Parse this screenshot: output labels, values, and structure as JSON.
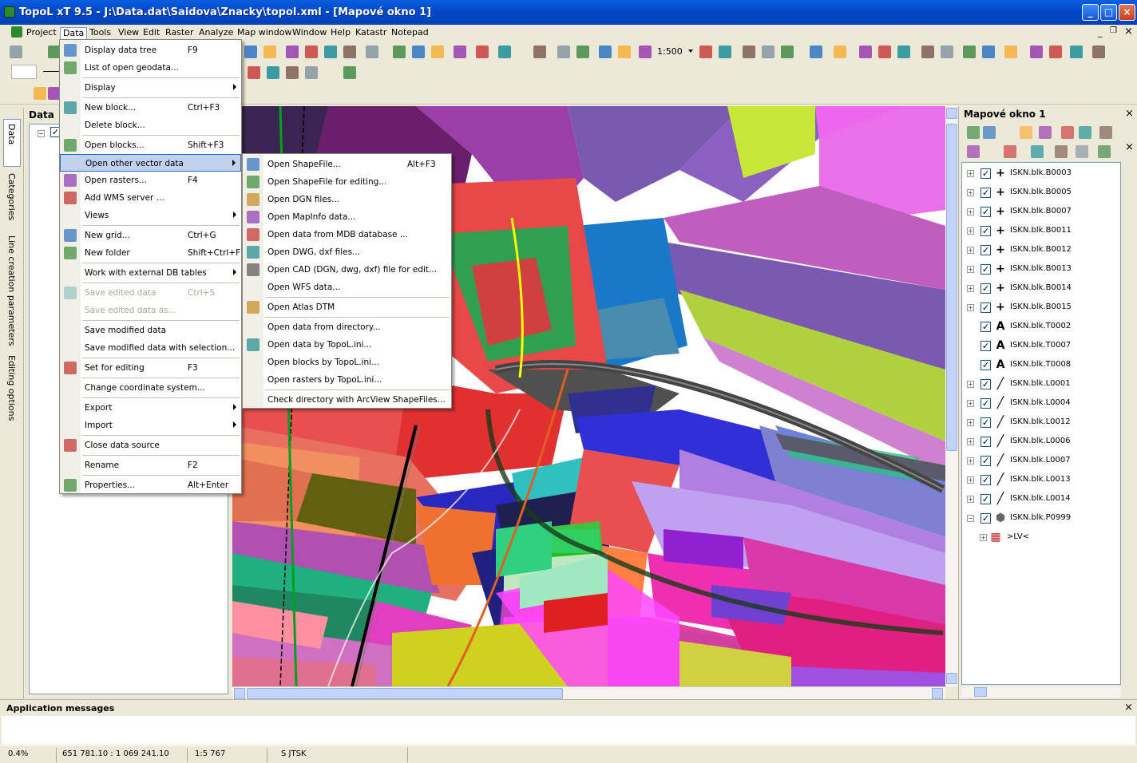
{
  "window": {
    "title": "TopoL xT 9.5 - J:\\Data.dat\\Saidova\\Znacky\\topol.xml - [Mapové okno 1]"
  },
  "menubar": [
    "Project",
    "Data",
    "Tools",
    "View",
    "Edit",
    "Raster",
    "Analyze",
    "Map window",
    "Window",
    "Help",
    "Katastr",
    "Notepad"
  ],
  "toolbar": {
    "scale": "1:500"
  },
  "left_tabs": [
    "Data",
    "Categories",
    "Line creation parameters",
    "Editing options"
  ],
  "data_panel": {
    "title": "Data"
  },
  "data_menu": [
    {
      "label": "Display data tree",
      "shortcut": "F9",
      "icon": "tree-icon"
    },
    {
      "label": "List of open geodata...",
      "shortcut": "",
      "icon": "list-icon"
    },
    {
      "sep": true
    },
    {
      "label": "Display",
      "shortcut": "",
      "submenu": true
    },
    {
      "sep": true
    },
    {
      "label": "New block...",
      "shortcut": "Ctrl+F3",
      "icon": "new-block-icon"
    },
    {
      "label": "Delete block...",
      "shortcut": ""
    },
    {
      "sep": true
    },
    {
      "label": "Open blocks...",
      "shortcut": "Shift+F3",
      "icon": "open-blocks-icon"
    },
    {
      "label": "Open other vector data",
      "shortcut": "",
      "submenu": true,
      "highlight": true
    },
    {
      "label": "Open rasters...",
      "shortcut": "F4",
      "icon": "raster-icon"
    },
    {
      "label": "Add WMS server ...",
      "shortcut": "",
      "icon": "globe-icon"
    },
    {
      "label": "Views",
      "shortcut": "",
      "submenu": true
    },
    {
      "sep": true
    },
    {
      "label": "New grid...",
      "shortcut": "Ctrl+G",
      "icon": "grid-icon"
    },
    {
      "label": "New folder",
      "shortcut": "Shift+Ctrl+F",
      "icon": "folder-icon"
    },
    {
      "sep": true
    },
    {
      "label": "Work with external DB tables",
      "shortcut": "",
      "submenu": true
    },
    {
      "sep": true
    },
    {
      "label": "Save edited data",
      "shortcut": "Ctrl+S",
      "disabled": true,
      "icon": "save-icon"
    },
    {
      "label": "Save edited data as...",
      "shortcut": "",
      "disabled": true
    },
    {
      "sep": true
    },
    {
      "label": "Save modified data",
      "shortcut": ""
    },
    {
      "label": "Save modified data with selection...",
      "shortcut": ""
    },
    {
      "sep": true
    },
    {
      "label": "Set for editing",
      "shortcut": "F3",
      "icon": "edit-icon"
    },
    {
      "sep": true
    },
    {
      "label": "Change coordinate system...",
      "shortcut": ""
    },
    {
      "sep": true
    },
    {
      "label": "Export",
      "shortcut": "",
      "submenu": true
    },
    {
      "label": "Import",
      "shortcut": "",
      "submenu": true
    },
    {
      "sep": true
    },
    {
      "label": "Close data source",
      "shortcut": "",
      "icon": "close-folder-icon"
    },
    {
      "sep": true
    },
    {
      "label": "Rename",
      "shortcut": "F2"
    },
    {
      "sep": true
    },
    {
      "label": "Properties...",
      "shortcut": "Alt+Enter",
      "icon": "properties-icon"
    }
  ],
  "vector_submenu": [
    {
      "label": "Open ShapeFile...",
      "shortcut": "Alt+F3",
      "icon": "shapefile-icon"
    },
    {
      "label": "Open ShapeFile for editing...",
      "shortcut": "",
      "icon": "shapefile-edit-icon"
    },
    {
      "label": "Open DGN files...",
      "shortcut": "",
      "icon": "dgn-icon"
    },
    {
      "label": "Open MapInfo data...",
      "shortcut": "",
      "icon": "mapinfo-icon"
    },
    {
      "label": "Open data from MDB database ...",
      "shortcut": "",
      "icon": "database-icon"
    },
    {
      "label": "Open DWG, dxf files...",
      "shortcut": "",
      "icon": "dwg-icon"
    },
    {
      "label": "Open CAD (DGN, dwg, dxf) file for edit...",
      "shortcut": "",
      "icon": "cad-icon"
    },
    {
      "label": "Open WFS data...",
      "shortcut": ""
    },
    {
      "sep": true
    },
    {
      "label": "Open Atlas DTM",
      "shortcut": "",
      "icon": "atlas-icon"
    },
    {
      "sep": true
    },
    {
      "label": "Open data from directory...",
      "shortcut": ""
    },
    {
      "label": "Open data by TopoL.ini...",
      "shortcut": "",
      "icon": "ini-icon"
    },
    {
      "label": "Open blocks by TopoL.ini...",
      "shortcut": ""
    },
    {
      "label": "Open rasters by TopoL.ini...",
      "shortcut": ""
    },
    {
      "sep": true
    },
    {
      "label": "Check directory with ArcView ShapeFiles...",
      "shortcut": ""
    }
  ],
  "right_panel": {
    "title": "Mapové okno 1",
    "layers": [
      {
        "name": "ISKN.blk.B0003",
        "type": "point",
        "expander": "+"
      },
      {
        "name": "ISKN.blk.B0005",
        "type": "point",
        "expander": "+"
      },
      {
        "name": "ISKN.blk.B0007",
        "type": "point",
        "expander": "+"
      },
      {
        "name": "ISKN.blk.B0011",
        "type": "point",
        "expander": "+"
      },
      {
        "name": "ISKN.blk.B0012",
        "type": "point",
        "expander": "+"
      },
      {
        "name": "ISKN.blk.B0013",
        "type": "point",
        "expander": "+"
      },
      {
        "name": "ISKN.blk.B0014",
        "type": "point",
        "expander": "+"
      },
      {
        "name": "ISKN.blk.B0015",
        "type": "point",
        "expander": "+"
      },
      {
        "name": "ISKN.blk.T0002",
        "type": "text",
        "expander": ""
      },
      {
        "name": "ISKN.blk.T0007",
        "type": "text",
        "expander": ""
      },
      {
        "name": "ISKN.blk.T0008",
        "type": "text",
        "expander": ""
      },
      {
        "name": "ISKN.blk.L0001",
        "type": "line",
        "expander": "+"
      },
      {
        "name": "ISKN.blk.L0004",
        "type": "line",
        "expander": "+"
      },
      {
        "name": "ISKN.blk.L0012",
        "type": "line",
        "expander": "+"
      },
      {
        "name": "ISKN.blk.L0006",
        "type": "line",
        "expander": "+"
      },
      {
        "name": "ISKN.blk.L0007",
        "type": "line",
        "expander": "+"
      },
      {
        "name": "ISKN.blk.L0013",
        "type": "line",
        "expander": "+"
      },
      {
        "name": "ISKN.blk.L0014",
        "type": "line",
        "expander": "+"
      },
      {
        "name": "ISKN.blk.P0999",
        "type": "polygon",
        "expander": "−"
      },
      {
        "name": ">LV<",
        "type": "category",
        "expander": "+",
        "child": true
      }
    ]
  },
  "messages": {
    "title": "Application messages"
  },
  "status": {
    "zoom": "0.4%",
    "coords": "651 781.10 : 1 069 241.10",
    "scale": "1:5 767",
    "crs": "S JTSK"
  }
}
